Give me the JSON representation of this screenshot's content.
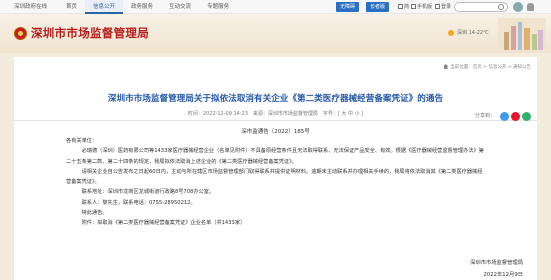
{
  "topbar": {
    "portal": "深圳政府在线",
    "nav": [
      "首页",
      "信息公开",
      "政务服务",
      "互动交流",
      "专题服务"
    ],
    "active_index": 1,
    "buttons": [
      {
        "label": "无障碍",
        "color": "#2a6fc2"
      },
      {
        "label": "长者版",
        "color": "#2a6fc2"
      }
    ],
    "links": [
      "简",
      "手机版",
      "登录"
    ]
  },
  "header": {
    "site_name": "深圳市市场监督管理局",
    "weather": "深圳 14-22℃"
  },
  "breadcrumb": "当前位置：首页 > 信息公开 > 通知公告",
  "article": {
    "title": "深圳市市场监督管理局关于拟依法取消有关企业《第二类医疗器械经营备案凭证》的通告",
    "meta": "时间：2022-12-09 14:23　来源：深圳市市场监督管理局　字号：[ 大  中  小 ]",
    "share_label": "分享到：",
    "share_colors": [
      "#3d9be9",
      "#e6162d",
      "#32b16c"
    ],
    "doc_number": "深市监通告〔2022〕185号",
    "paragraphs": [
      "各有关单位：",
      "　　　必瑞德（深圳）医药有限公司等1433家医疗器械经营企业（名单见附件）不具备原经营条件且无法取得联系、无法保证产品安全、有效。根据《医疗器械经营监督管理办法》第",
      "二十五条第二款、第二十四条的规定，我局拟依法取消上述企业的《第二类医疗器械经营备案凭证》。",
      "　　　请相关企业自公告发布之日起60日内，主动与所在辖区市场监督管理部门取得联系并提供证明材料。逾期未主动联系并办理相关手续的，我局将依法取消其《第二类医疗器械经",
      "营备案凭证》。",
      "　　　联系地址：深圳市龙岗区龙城街道行政路8号708办公室。",
      "　　　联系人：黎先生，联系电话：0755-28950212。",
      "　　　特此通告。",
      "　　　附件：拟取消《第二类医疗器械经营备案凭证》企业名单（共1433家）"
    ],
    "signature": "深圳市市场监督管理局",
    "date": "2022年12月9日"
  }
}
